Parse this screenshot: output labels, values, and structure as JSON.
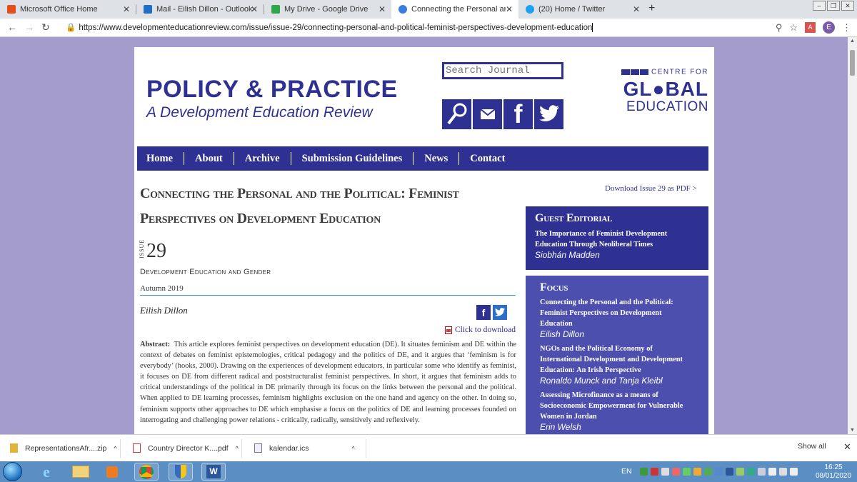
{
  "browser": {
    "tabs": [
      {
        "title": "Microsoft Office Home",
        "icon_color": "#e74c1c"
      },
      {
        "title": "Mail - Eilish Dillon - Outlook",
        "icon_color": "#1e6fc5"
      },
      {
        "title": "My Drive - Google Drive",
        "icon_color": "#2ea64a"
      },
      {
        "title": "Connecting the Personal and the",
        "icon_color": "#3b7de0"
      },
      {
        "title": "(20) Home / Twitter",
        "icon_color": "#1da1f2"
      }
    ],
    "url": "https://www.developmenteducationreview.com/issue/issue-29/connecting-personal-and-political-feminist-perspectives-development-education",
    "profile_initial": "E"
  },
  "site": {
    "title": "POLICY & PRACTICE",
    "subtitle": "A Development Education Review",
    "search_placeholder": "Search Journal",
    "centre_for": "CENTRE FOR",
    "global": "GL●BAL",
    "education": "EDUCATION",
    "nav": [
      "Home",
      "About",
      "Archive",
      "Submission Guidelines",
      "News",
      "Contact"
    ]
  },
  "article": {
    "title": "Connecting the Personal and the Political: Feminist Perspectives on Development Education",
    "issue_label": "ISSUE",
    "issue_number": "29",
    "theme": "Development Education and Gender",
    "season": "Autumn 2019",
    "author": "Eilish Dillon",
    "download_link": "Click to download",
    "abstract_label": "Abstract:",
    "abstract_text": "This article explores feminist perspectives on development education (DE). It situates feminism and DE within the context of debates on feminist epistemologies, critical pedagogy and the politics of DE, and it argues that ‘feminism is for everybody’ (hooks, 2000). Drawing on the experiences of development educators, in particular some who identify as feminist, it focuses on DE from different radical and poststructuralist feminist perspectives. In short, it argues that feminism adds to critical understandings of the political in DE primarily through its focus on the links between the personal and the political. When applied to DE learning processes, feminism highlights exclusion on the one hand and agency on the other. In doing so, feminism supports other approaches to DE which emphasise a focus on the politics of DE and learning processes founded on interrogating and challenging power relations - critically, radically, sensitively and reflexively."
  },
  "sidebar": {
    "download_issue": "Download Issue 29 as PDF >",
    "guest_editorial": {
      "heading": "Guest Editorial",
      "title": "The Importance of Feminist Development Education Through Neoliberal Times",
      "author": "Siobhán Madden"
    },
    "focus": {
      "heading": "Focus",
      "items": [
        {
          "title": "Connecting the Personal and the Political: Feminist Perspectives on Development Education",
          "author": "Eilish Dillon"
        },
        {
          "title": "NGOs and the Political Economy of International Development and Development Education: An Irish Perspective",
          "author": "Ronaldo Munck and Tanja Kleibl"
        },
        {
          "title": "Assessing Microfinance as a means of Socioeconomic Empowerment for Vulnerable Women in Jordan",
          "author": "Erin Welsh"
        }
      ]
    }
  },
  "downloads": {
    "items": [
      "RepresentationsAfr....zip",
      "Country Director K....pdf",
      "kalendar.ics"
    ],
    "show_all": "Show all"
  },
  "taskbar": {
    "lang": "EN",
    "time": "16:25",
    "date": "08/01/2020"
  },
  "colors": {
    "brand_navy": "#2e3192",
    "page_bg": "#a49ccd",
    "focus_bg": "#4c4fae"
  }
}
